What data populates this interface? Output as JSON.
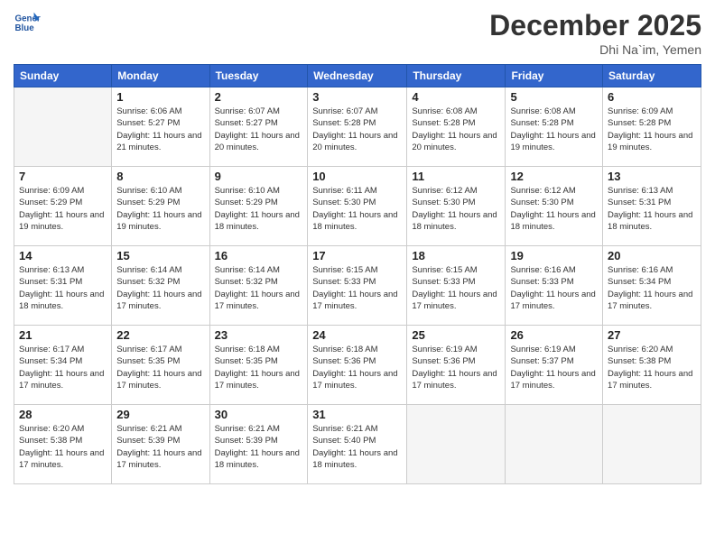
{
  "logo": {
    "line1": "General",
    "line2": "Blue"
  },
  "header": {
    "month": "December 2025",
    "location": "Dhi Na`im, Yemen"
  },
  "weekdays": [
    "Sunday",
    "Monday",
    "Tuesday",
    "Wednesday",
    "Thursday",
    "Friday",
    "Saturday"
  ],
  "weeks": [
    [
      {
        "day": "",
        "sunrise": "",
        "sunset": "",
        "daylight": ""
      },
      {
        "day": "1",
        "sunrise": "Sunrise: 6:06 AM",
        "sunset": "Sunset: 5:27 PM",
        "daylight": "Daylight: 11 hours and 21 minutes."
      },
      {
        "day": "2",
        "sunrise": "Sunrise: 6:07 AM",
        "sunset": "Sunset: 5:27 PM",
        "daylight": "Daylight: 11 hours and 20 minutes."
      },
      {
        "day": "3",
        "sunrise": "Sunrise: 6:07 AM",
        "sunset": "Sunset: 5:28 PM",
        "daylight": "Daylight: 11 hours and 20 minutes."
      },
      {
        "day": "4",
        "sunrise": "Sunrise: 6:08 AM",
        "sunset": "Sunset: 5:28 PM",
        "daylight": "Daylight: 11 hours and 20 minutes."
      },
      {
        "day": "5",
        "sunrise": "Sunrise: 6:08 AM",
        "sunset": "Sunset: 5:28 PM",
        "daylight": "Daylight: 11 hours and 19 minutes."
      },
      {
        "day": "6",
        "sunrise": "Sunrise: 6:09 AM",
        "sunset": "Sunset: 5:28 PM",
        "daylight": "Daylight: 11 hours and 19 minutes."
      }
    ],
    [
      {
        "day": "7",
        "sunrise": "Sunrise: 6:09 AM",
        "sunset": "Sunset: 5:29 PM",
        "daylight": "Daylight: 11 hours and 19 minutes."
      },
      {
        "day": "8",
        "sunrise": "Sunrise: 6:10 AM",
        "sunset": "Sunset: 5:29 PM",
        "daylight": "Daylight: 11 hours and 19 minutes."
      },
      {
        "day": "9",
        "sunrise": "Sunrise: 6:10 AM",
        "sunset": "Sunset: 5:29 PM",
        "daylight": "Daylight: 11 hours and 18 minutes."
      },
      {
        "day": "10",
        "sunrise": "Sunrise: 6:11 AM",
        "sunset": "Sunset: 5:30 PM",
        "daylight": "Daylight: 11 hours and 18 minutes."
      },
      {
        "day": "11",
        "sunrise": "Sunrise: 6:12 AM",
        "sunset": "Sunset: 5:30 PM",
        "daylight": "Daylight: 11 hours and 18 minutes."
      },
      {
        "day": "12",
        "sunrise": "Sunrise: 6:12 AM",
        "sunset": "Sunset: 5:30 PM",
        "daylight": "Daylight: 11 hours and 18 minutes."
      },
      {
        "day": "13",
        "sunrise": "Sunrise: 6:13 AM",
        "sunset": "Sunset: 5:31 PM",
        "daylight": "Daylight: 11 hours and 18 minutes."
      }
    ],
    [
      {
        "day": "14",
        "sunrise": "Sunrise: 6:13 AM",
        "sunset": "Sunset: 5:31 PM",
        "daylight": "Daylight: 11 hours and 18 minutes."
      },
      {
        "day": "15",
        "sunrise": "Sunrise: 6:14 AM",
        "sunset": "Sunset: 5:32 PM",
        "daylight": "Daylight: 11 hours and 17 minutes."
      },
      {
        "day": "16",
        "sunrise": "Sunrise: 6:14 AM",
        "sunset": "Sunset: 5:32 PM",
        "daylight": "Daylight: 11 hours and 17 minutes."
      },
      {
        "day": "17",
        "sunrise": "Sunrise: 6:15 AM",
        "sunset": "Sunset: 5:33 PM",
        "daylight": "Daylight: 11 hours and 17 minutes."
      },
      {
        "day": "18",
        "sunrise": "Sunrise: 6:15 AM",
        "sunset": "Sunset: 5:33 PM",
        "daylight": "Daylight: 11 hours and 17 minutes."
      },
      {
        "day": "19",
        "sunrise": "Sunrise: 6:16 AM",
        "sunset": "Sunset: 5:33 PM",
        "daylight": "Daylight: 11 hours and 17 minutes."
      },
      {
        "day": "20",
        "sunrise": "Sunrise: 6:16 AM",
        "sunset": "Sunset: 5:34 PM",
        "daylight": "Daylight: 11 hours and 17 minutes."
      }
    ],
    [
      {
        "day": "21",
        "sunrise": "Sunrise: 6:17 AM",
        "sunset": "Sunset: 5:34 PM",
        "daylight": "Daylight: 11 hours and 17 minutes."
      },
      {
        "day": "22",
        "sunrise": "Sunrise: 6:17 AM",
        "sunset": "Sunset: 5:35 PM",
        "daylight": "Daylight: 11 hours and 17 minutes."
      },
      {
        "day": "23",
        "sunrise": "Sunrise: 6:18 AM",
        "sunset": "Sunset: 5:35 PM",
        "daylight": "Daylight: 11 hours and 17 minutes."
      },
      {
        "day": "24",
        "sunrise": "Sunrise: 6:18 AM",
        "sunset": "Sunset: 5:36 PM",
        "daylight": "Daylight: 11 hours and 17 minutes."
      },
      {
        "day": "25",
        "sunrise": "Sunrise: 6:19 AM",
        "sunset": "Sunset: 5:36 PM",
        "daylight": "Daylight: 11 hours and 17 minutes."
      },
      {
        "day": "26",
        "sunrise": "Sunrise: 6:19 AM",
        "sunset": "Sunset: 5:37 PM",
        "daylight": "Daylight: 11 hours and 17 minutes."
      },
      {
        "day": "27",
        "sunrise": "Sunrise: 6:20 AM",
        "sunset": "Sunset: 5:38 PM",
        "daylight": "Daylight: 11 hours and 17 minutes."
      }
    ],
    [
      {
        "day": "28",
        "sunrise": "Sunrise: 6:20 AM",
        "sunset": "Sunset: 5:38 PM",
        "daylight": "Daylight: 11 hours and 17 minutes."
      },
      {
        "day": "29",
        "sunrise": "Sunrise: 6:21 AM",
        "sunset": "Sunset: 5:39 PM",
        "daylight": "Daylight: 11 hours and 17 minutes."
      },
      {
        "day": "30",
        "sunrise": "Sunrise: 6:21 AM",
        "sunset": "Sunset: 5:39 PM",
        "daylight": "Daylight: 11 hours and 18 minutes."
      },
      {
        "day": "31",
        "sunrise": "Sunrise: 6:21 AM",
        "sunset": "Sunset: 5:40 PM",
        "daylight": "Daylight: 11 hours and 18 minutes."
      },
      {
        "day": "",
        "sunrise": "",
        "sunset": "",
        "daylight": ""
      },
      {
        "day": "",
        "sunrise": "",
        "sunset": "",
        "daylight": ""
      },
      {
        "day": "",
        "sunrise": "",
        "sunset": "",
        "daylight": ""
      }
    ]
  ]
}
